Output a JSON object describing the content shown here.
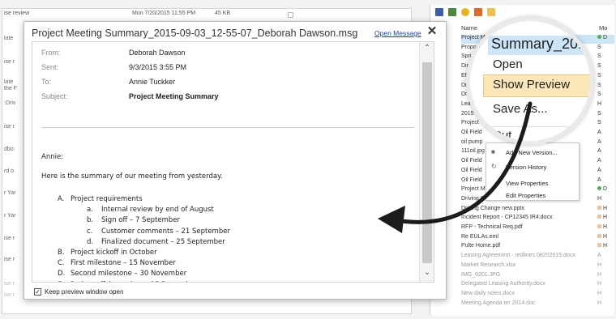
{
  "left_list": {
    "top_row": {
      "subject": "ise review",
      "date": "Mon 7/20/2015 11:55 PM",
      "size": "45 KB"
    },
    "fragments": [
      "late",
      "ise r",
      "late",
      "the F",
      ":Driv",
      "ise r",
      "dbo:",
      "rd o",
      "r Yar",
      "r Yar",
      "ise r",
      "ise r",
      "ise r",
      "ise r"
    ]
  },
  "preview": {
    "title": "Project Meeting Summary_2015-09-03_12-55-07_Deborah Dawson.msg",
    "open_message": "Open Message",
    "close_symbol": "✕",
    "headers": [
      {
        "label": "From:",
        "value": "Deborah Dawson"
      },
      {
        "label": "Sent:",
        "value": "9/3/2015 3:55 PM"
      },
      {
        "label": "To:",
        "value": "Annie Tuckker"
      },
      {
        "label": "Subject:",
        "value": "Project Meeting Summary"
      }
    ],
    "greeting": "Annie:",
    "intro": "Here is the summary of our meeting from yesterday.",
    "outline": [
      {
        "marker": "A.",
        "text": "Project requirements",
        "level": 1
      },
      {
        "marker": "a.",
        "text": "Internal review by end of August",
        "level": 2
      },
      {
        "marker": "b.",
        "text": "Sign off – 7 September",
        "level": 2
      },
      {
        "marker": "c.",
        "text": "Customer comments – 21 September",
        "level": 2
      },
      {
        "marker": "d.",
        "text": "Finalized document – 25 September",
        "level": 2
      },
      {
        "marker": "B.",
        "text": "Project kickoff in October",
        "level": 1
      },
      {
        "marker": "C.",
        "text": "First milestone – 15 November",
        "level": 1
      },
      {
        "marker": "D.",
        "text": "Second milestone – 30 November",
        "level": 1
      },
      {
        "marker": "E.",
        "text": "Project offsite review – 15 December",
        "level": 1
      }
    ],
    "keep_open_label": "Keep preview window open",
    "keep_open_checked": true
  },
  "file_panel": {
    "columns": {
      "name": "Name",
      "modified": "Mo"
    },
    "files": [
      {
        "name": "Project M",
        "mod": "D",
        "selected": true,
        "faded": false,
        "dot": "green"
      },
      {
        "name": "Propo",
        "mod": "S",
        "faded": false
      },
      {
        "name": "Spri",
        "mod": "S",
        "faded": false
      },
      {
        "name": "Dir",
        "mod": "S",
        "faded": false
      },
      {
        "name": "EF",
        "mod": "S",
        "faded": false
      },
      {
        "name": "Dr",
        "mod": "S",
        "faded": false
      },
      {
        "name": "Dr",
        "mod": "S",
        "faded": false
      },
      {
        "name": "Lea",
        "mod": "H",
        "faded": false
      },
      {
        "name": "2015",
        "mod": "S",
        "faded": false
      },
      {
        "name": "Project",
        "mod": "S",
        "faded": false
      },
      {
        "name": "Oil Field",
        "mod": "A",
        "faded": false
      },
      {
        "name": "oil pump",
        "mod": "A",
        "faded": false
      },
      {
        "name": "111oil.jpg",
        "mod": "A",
        "faded": false
      },
      {
        "name": "Oil Field",
        "mod": "A",
        "faded": false
      },
      {
        "name": "Oil Field",
        "mod": "A",
        "faded": false
      },
      {
        "name": "Oil Field",
        "mod": "A",
        "faded": false
      },
      {
        "name": "Project M",
        "mod": "D",
        "faded": false,
        "dot": "green"
      },
      {
        "name": "Driving C",
        "mod": "H",
        "faded": false
      },
      {
        "name": "Driving Change new.pptx",
        "mod": "H",
        "faded": false,
        "dot": "peach"
      },
      {
        "name": "Incident Report - CP12345 IR4.docx",
        "mod": "H",
        "faded": false,
        "dot": "peach"
      },
      {
        "name": "RFP - Technical Req.pdf",
        "mod": "H",
        "faded": false,
        "dot": "peach"
      },
      {
        "name": "Re EULAs.eml",
        "mod": "H",
        "faded": false,
        "dot": "peach"
      },
      {
        "name": "Pulte Home.pdf",
        "mod": "H",
        "faded": false,
        "dot": "peach"
      },
      {
        "name": "Leasing Agreement - redlines 08202015.docx",
        "mod": "A",
        "faded": true
      },
      {
        "name": "Market Research.xlsx",
        "mod": "H",
        "faded": true
      },
      {
        "name": "IMG_0201.JPG",
        "mod": "H",
        "faded": true
      },
      {
        "name": "Delegated Leasing Authority.docx",
        "mod": "H",
        "faded": true
      },
      {
        "name": "New daily notes.docx",
        "mod": "H",
        "faded": true
      },
      {
        "name": "Meeting Agenda ter 2014.doc",
        "mod": "H",
        "faded": true
      }
    ],
    "context_menu": [
      {
        "label": "Add New Version..."
      },
      {
        "label": "Version History"
      },
      {
        "label": "View Properties"
      },
      {
        "label": "Edit Properties"
      }
    ]
  },
  "magnifier": {
    "title_row": "Summary_201",
    "items": [
      "Open",
      "Show Preview",
      "Save As...",
      "Cut"
    ],
    "highlighted": "Show Preview",
    "highlight_color": "#fbe7b8"
  },
  "colors": {
    "link": "#1a3fb8",
    "selection": "#cde6f7",
    "arrow": "#1c1c1c",
    "menu_highlight": "#fbe7b8"
  }
}
